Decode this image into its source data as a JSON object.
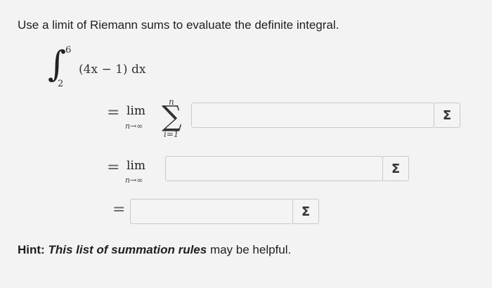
{
  "question": {
    "prompt": "Use a limit of Riemann sums to evaluate the definite integral.",
    "integral": {
      "upper_limit": "6",
      "lower_limit": "2",
      "integrand": "(4x − 1) dx"
    }
  },
  "steps": [
    {
      "equals": "=",
      "lim": "lim",
      "lim_sub": "n→∞",
      "sum_top": "n",
      "sum_bottom": "i=1",
      "input_value": "",
      "button_label": "Σ"
    },
    {
      "equals": "=",
      "lim": "lim",
      "lim_sub": "n→∞",
      "input_value": "",
      "button_label": "Σ"
    },
    {
      "equals": "=",
      "input_value": "",
      "button_label": "Σ"
    }
  ],
  "hint": {
    "label": "Hint:",
    "link_text": "This list of summation rules",
    "suffix": " may be helpful."
  }
}
